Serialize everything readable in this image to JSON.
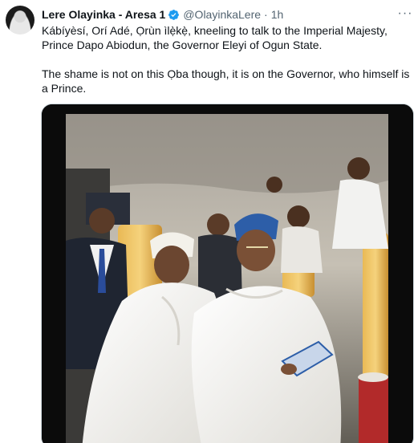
{
  "author": {
    "display_name": "Lere Olayinka - Aresa 1",
    "handle": "@OlayinkaLere",
    "separator": "·",
    "time": "1h",
    "verified_icon": "verified-badge-icon"
  },
  "tweet": {
    "paragraphs": [
      "Kábíyèsí, Orí Adé, Ọrùn ìlẹ̀kẹ̀, kneeling to talk to the Imperial Majesty, Prince Dapo Abiodun, the Governor Eleyi of Ogun State.",
      "The shame is not on this Ọba though, it is on the Governor, who himself is a Prince."
    ]
  },
  "more_menu": {
    "icon": "more-options-icon",
    "glyph": "···"
  },
  "media": {
    "kind": "video-still",
    "description_colors": {
      "backdrop": "#b9b2a6",
      "robe": "#f4f4f2",
      "cap": "#2d5ea8",
      "chairs": "#d9a748"
    }
  }
}
